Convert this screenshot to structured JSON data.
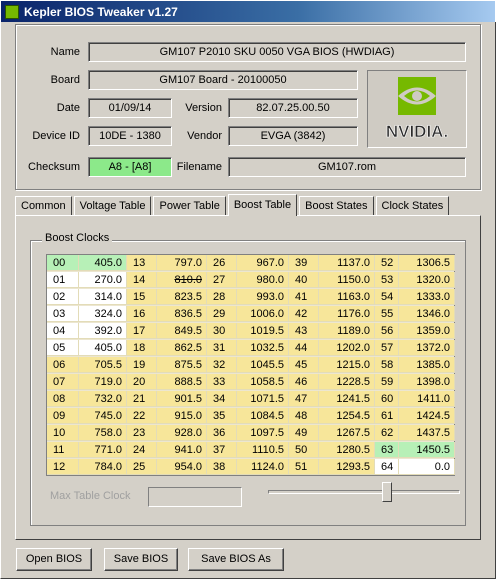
{
  "window": {
    "title": "Kepler BIOS Tweaker v1.27"
  },
  "info": {
    "name_label": "Name",
    "name_value": "GM107 P2010 SKU 0050 VGA BIOS (HWDIAG)",
    "board_label": "Board",
    "board_value": "GM107 Board - 20100050",
    "date_label": "Date",
    "date_value": "01/09/14",
    "version_label": "Version",
    "version_value": "82.07.25.00.50",
    "deviceid_label": "Device ID",
    "deviceid_value": "10DE - 1380",
    "vendor_label": "Vendor",
    "vendor_value": "EVGA (3842)",
    "checksum_label": "Checksum",
    "checksum_value": "A8 - [A8]",
    "filename_label": "Filename",
    "filename_value": "GM107.rom",
    "logo_text": "NVIDIA."
  },
  "tabs": [
    "Common",
    "Voltage Table",
    "Power Table",
    "Boost Table",
    "Boost States",
    "Clock States"
  ],
  "active_tab": 3,
  "boost": {
    "group_title": "Boost Clocks",
    "max_table_clock_label": "Max Table Clock",
    "columns": [
      [
        [
          "00",
          "405.0"
        ],
        [
          "01",
          "270.0"
        ],
        [
          "02",
          "314.0"
        ],
        [
          "03",
          "324.0"
        ],
        [
          "04",
          "392.0"
        ],
        [
          "05",
          "405.0"
        ],
        [
          "06",
          "705.5"
        ],
        [
          "07",
          "719.0"
        ],
        [
          "08",
          "732.0"
        ],
        [
          "09",
          "745.0"
        ],
        [
          "10",
          "758.0"
        ],
        [
          "11",
          "771.0"
        ],
        [
          "12",
          "784.0"
        ]
      ],
      [
        [
          "13",
          "797.0"
        ],
        [
          "14",
          "810.0"
        ],
        [
          "15",
          "823.5"
        ],
        [
          "16",
          "836.5"
        ],
        [
          "17",
          "849.5"
        ],
        [
          "18",
          "862.5"
        ],
        [
          "19",
          "875.5"
        ],
        [
          "20",
          "888.5"
        ],
        [
          "21",
          "901.5"
        ],
        [
          "22",
          "915.0"
        ],
        [
          "23",
          "928.0"
        ],
        [
          "24",
          "941.0"
        ],
        [
          "25",
          "954.0"
        ]
      ],
      [
        [
          "26",
          "967.0"
        ],
        [
          "27",
          "980.0"
        ],
        [
          "28",
          "993.0"
        ],
        [
          "29",
          "1006.0"
        ],
        [
          "30",
          "1019.5"
        ],
        [
          "31",
          "1032.5"
        ],
        [
          "32",
          "1045.5"
        ],
        [
          "33",
          "1058.5"
        ],
        [
          "34",
          "1071.5"
        ],
        [
          "35",
          "1084.5"
        ],
        [
          "36",
          "1097.5"
        ],
        [
          "37",
          "1110.5"
        ],
        [
          "38",
          "1124.0"
        ]
      ],
      [
        [
          "39",
          "1137.0"
        ],
        [
          "40",
          "1150.0"
        ],
        [
          "41",
          "1163.0"
        ],
        [
          "42",
          "1176.0"
        ],
        [
          "43",
          "1189.0"
        ],
        [
          "44",
          "1202.0"
        ],
        [
          "45",
          "1215.0"
        ],
        [
          "46",
          "1228.5"
        ],
        [
          "47",
          "1241.5"
        ],
        [
          "48",
          "1254.5"
        ],
        [
          "49",
          "1267.5"
        ],
        [
          "50",
          "1280.5"
        ],
        [
          "51",
          "1293.5"
        ]
      ],
      [
        [
          "52",
          "1306.5"
        ],
        [
          "53",
          "1320.0"
        ],
        [
          "54",
          "1333.0"
        ],
        [
          "55",
          "1346.0"
        ],
        [
          "56",
          "1359.0"
        ],
        [
          "57",
          "1372.0"
        ],
        [
          "58",
          "1385.0"
        ],
        [
          "59",
          "1398.0"
        ],
        [
          "60",
          "1411.0"
        ],
        [
          "61",
          "1424.5"
        ],
        [
          "62",
          "1437.5"
        ],
        [
          "63",
          "1450.5"
        ],
        [
          "64",
          "0.0"
        ]
      ]
    ],
    "slider_fraction": 0.62
  },
  "buttons": {
    "open": "Open BIOS",
    "save": "Save BIOS",
    "save_as": "Save BIOS As"
  },
  "colors": {
    "yellow_cell": "#f7e69a",
    "white_cell": "#ffffff",
    "green_cell": "#b7f0b7",
    "checksum_green": "#8ce98a",
    "nvidia_green": "#76b900"
  }
}
